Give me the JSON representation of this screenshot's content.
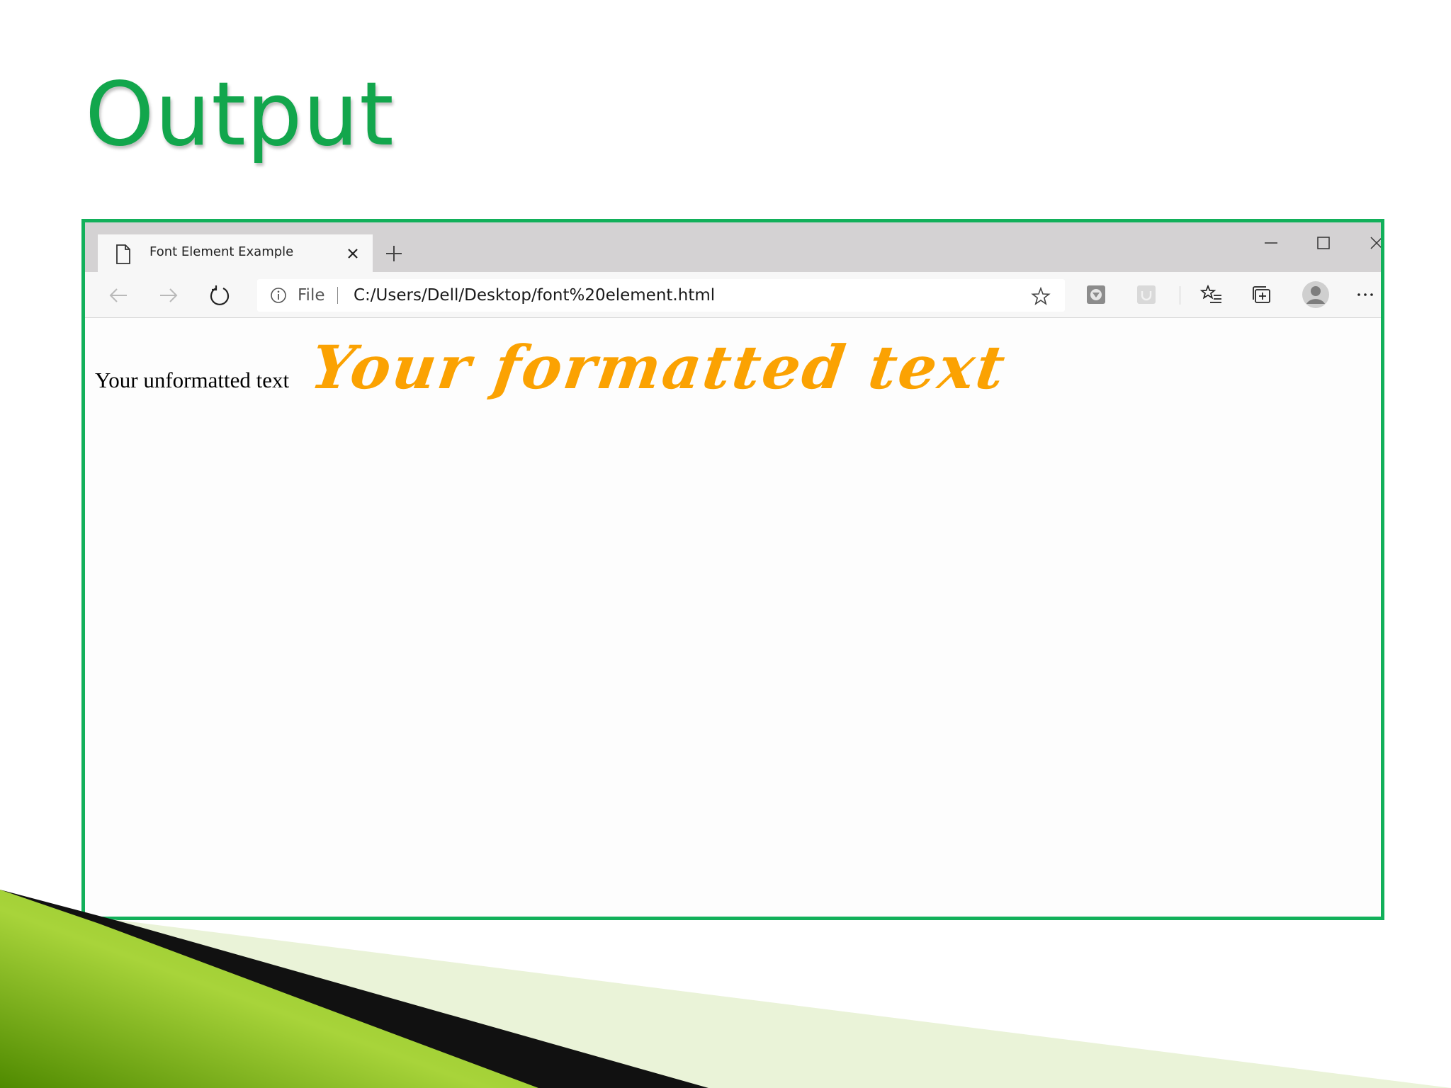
{
  "slide": {
    "title": "Output"
  },
  "browser": {
    "tab_title": "Font Element Example",
    "address": {
      "scheme_label": "File",
      "url": "C:/Users/Dell/Desktop/font%20element.html"
    }
  },
  "page": {
    "unformatted_text": "Your unformatted text",
    "formatted_text": "Your formatted text",
    "formatted_color": "#fba202"
  },
  "colors": {
    "title_green": "#12a64c",
    "frame_green": "#12b05a"
  }
}
